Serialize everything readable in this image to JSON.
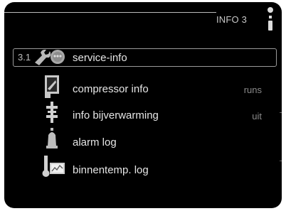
{
  "header": {
    "title": "INFO 3"
  },
  "menu": {
    "selected_number": "3.1",
    "items": [
      {
        "label": "service-info",
        "value": ""
      },
      {
        "label": "compressor info",
        "value": "runs"
      },
      {
        "label": "info bijverwarming",
        "value": "uit"
      },
      {
        "label": "alarm log",
        "value": ""
      },
      {
        "label": "binnentemp. log",
        "value": ""
      }
    ]
  },
  "icons": [
    "wrench-icon",
    "compressor-icon",
    "heater-icon",
    "bell-icon",
    "thermometer-graph-icon",
    "thermometer-status-icon"
  ],
  "colors": {
    "background": "#000000",
    "text": "#e6e6e6",
    "value_text": "#8a8a8a",
    "selection_border": "#9a9a9a"
  }
}
